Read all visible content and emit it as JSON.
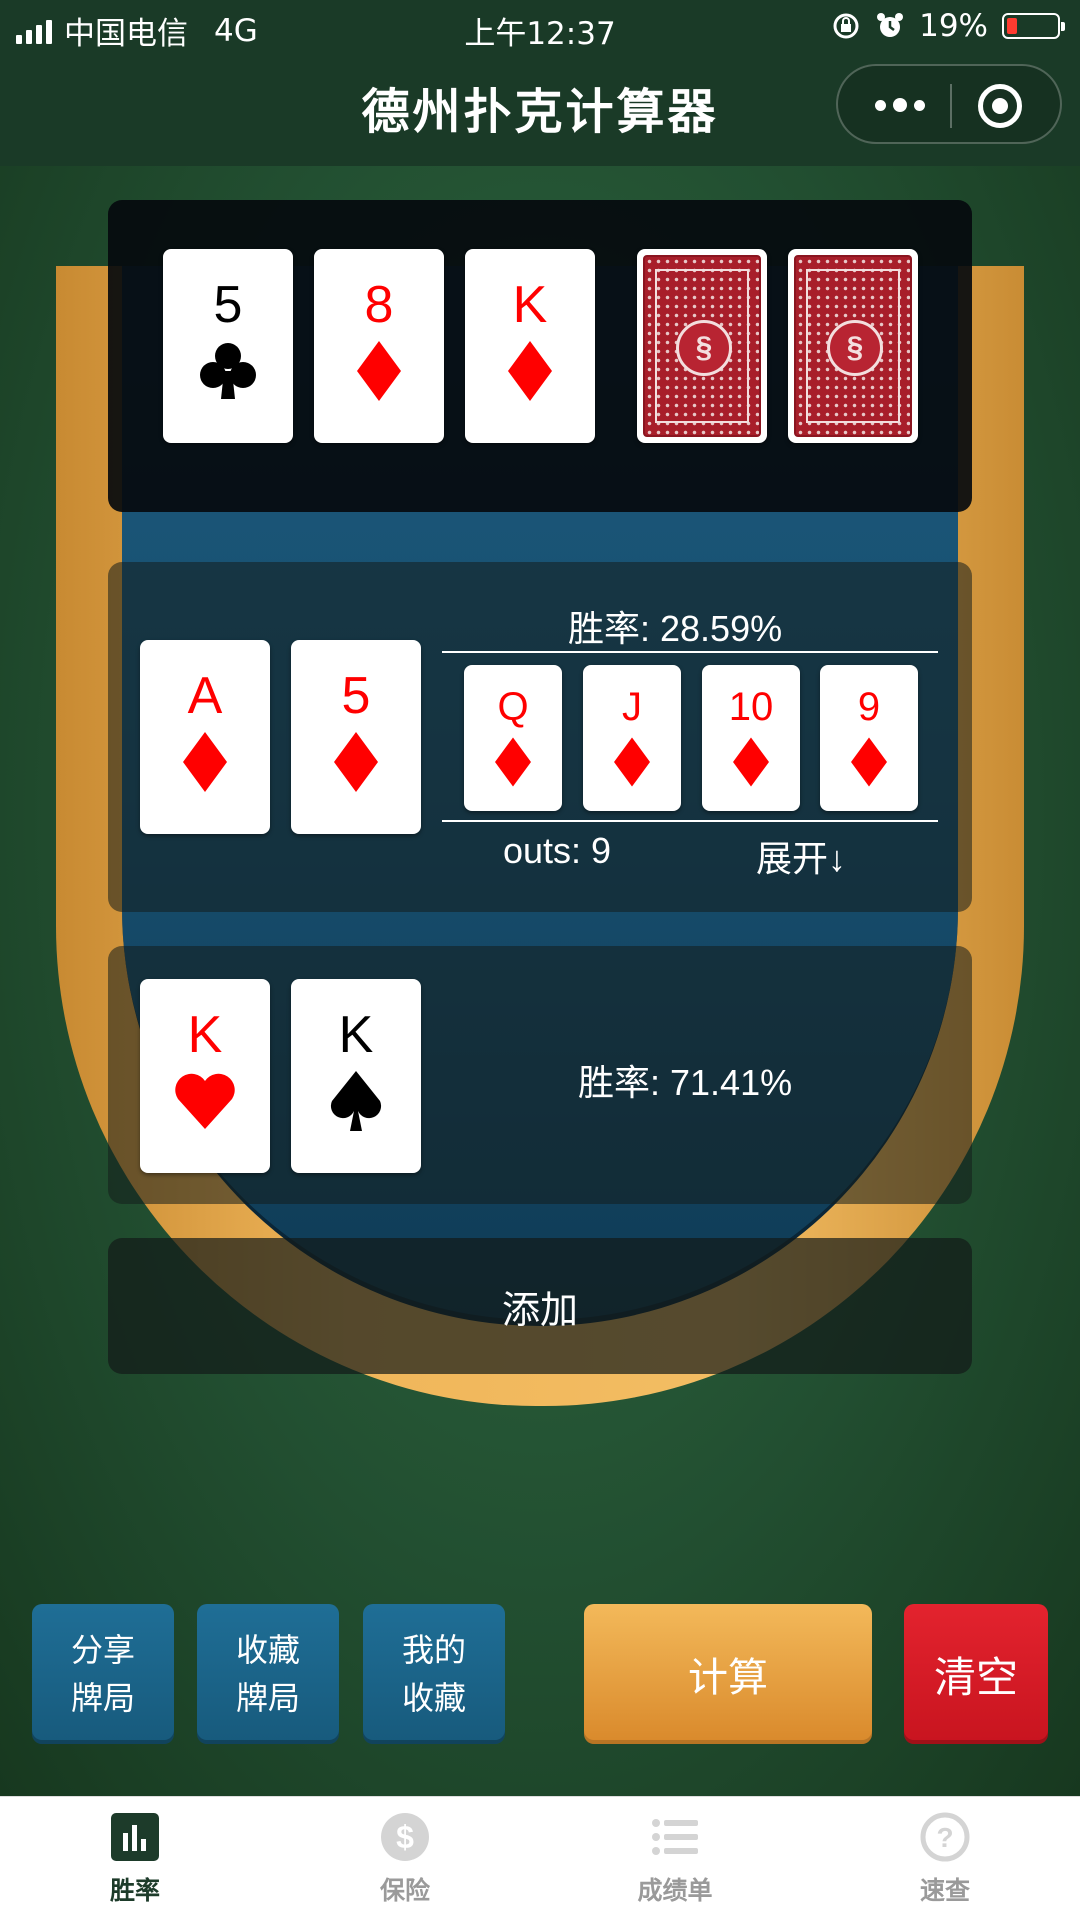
{
  "status_bar": {
    "carrier": "中国电信",
    "network": "4G",
    "time": "上午12:37",
    "battery": "19%"
  },
  "nav": {
    "title": "德州扑克计算器"
  },
  "board": {
    "cards": [
      {
        "rank": "5",
        "suit": "clubs",
        "color": "#000000"
      },
      {
        "rank": "8",
        "suit": "diamonds",
        "color": "#ff0000"
      },
      {
        "rank": "K",
        "suit": "diamonds",
        "color": "#ff0000"
      },
      {
        "rank": "",
        "suit": "back"
      },
      {
        "rank": "",
        "suit": "back"
      }
    ]
  },
  "player1": {
    "hole_cards": [
      {
        "rank": "A",
        "suit": "diamonds",
        "color": "#ff0000"
      },
      {
        "rank": "5",
        "suit": "diamonds",
        "color": "#ff0000"
      }
    ],
    "win_rate_label": "胜率: 28.59%",
    "out_cards": [
      {
        "rank": "Q",
        "suit": "diamonds",
        "color": "#ff0000"
      },
      {
        "rank": "J",
        "suit": "diamonds",
        "color": "#ff0000"
      },
      {
        "rank": "10",
        "suit": "diamonds",
        "color": "#ff0000"
      },
      {
        "rank": "9",
        "suit": "diamonds",
        "color": "#ff0000"
      }
    ],
    "outs_label": "outs: 9",
    "expand_label": "展开↓"
  },
  "player2": {
    "hole_cards": [
      {
        "rank": "K",
        "suit": "hearts",
        "color": "#ff0000"
      },
      {
        "rank": "K",
        "suit": "spades",
        "color": "#000000"
      }
    ],
    "win_rate_label": "胜率: 71.41%"
  },
  "add_label": "添加",
  "actions": {
    "share_line1": "分享",
    "share_line2": "牌局",
    "fav_line1": "收藏",
    "fav_line2": "牌局",
    "myfav_line1": "我的",
    "myfav_line2": "收藏",
    "calc": "计算",
    "clear": "清空"
  },
  "tabs": [
    {
      "label": "胜率",
      "icon": "bar-chart-icon",
      "active": true
    },
    {
      "label": "保险",
      "icon": "dollar-icon",
      "active": false
    },
    {
      "label": "成绩单",
      "icon": "list-icon",
      "active": false
    },
    {
      "label": "速查",
      "icon": "question-icon",
      "active": false
    }
  ],
  "colors": {
    "felt": "#224f31",
    "table_blue": "#174e6e",
    "rail": "#f0b65a",
    "calc_button": "#e8a445",
    "clear_button": "#d71a25",
    "action_blue": "#1b6489",
    "active_tab": "#1d3b2a"
  }
}
